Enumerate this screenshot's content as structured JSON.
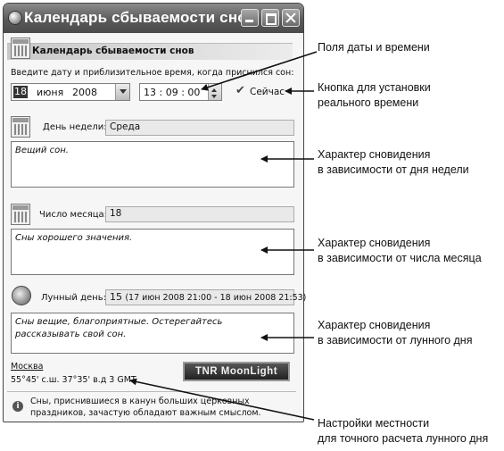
{
  "window": {
    "title": "Календарь сбываемости снов"
  },
  "panel": {
    "header": "Календарь сбываемости снов",
    "prompt": "Введите дату и приблизительное время, когда приснился сон:",
    "date": {
      "day": "18",
      "month": "июня",
      "year": "2008"
    },
    "time": "13 : 09 : 00",
    "now_button": "Сейчас",
    "weekday": {
      "label": "День недели:",
      "value": "Среда",
      "text": "Вещий сон."
    },
    "month_day": {
      "label": "Число месяца:",
      "value": "18",
      "text": "Сны хорошего значения."
    },
    "lunar_day": {
      "label": "Лунный день:",
      "value": "15",
      "range": "(17 июн 2008 21:00 - 18 июн 2008 21:53)",
      "text": "Сны вещие, благоприятные. Остерегайтесь рассказывать свой сон."
    },
    "location": {
      "name": "Москва",
      "coords": "55°45' с.ш.  37°35' в.д 3 GMT"
    },
    "logo": "TNR MoonLight",
    "tip": "Сны, приснившиеся в канун больших церковных праздников, зачастую обладают важным смыслом."
  },
  "annotations": {
    "datetime": "Поля даты и времени",
    "realtime": [
      "Кнопка для установки",
      "реального времени"
    ],
    "by_weekday": [
      "Характер сновидения",
      "в зависимости от дня недели"
    ],
    "by_monthday": [
      "Характер сновидения",
      "в зависимости от числа месяца"
    ],
    "by_lunarday": [
      "Характер сновидения",
      "в зависимости от лунного дня"
    ],
    "location": [
      "Настройки местности",
      "для точного расчета лунного дня"
    ]
  }
}
